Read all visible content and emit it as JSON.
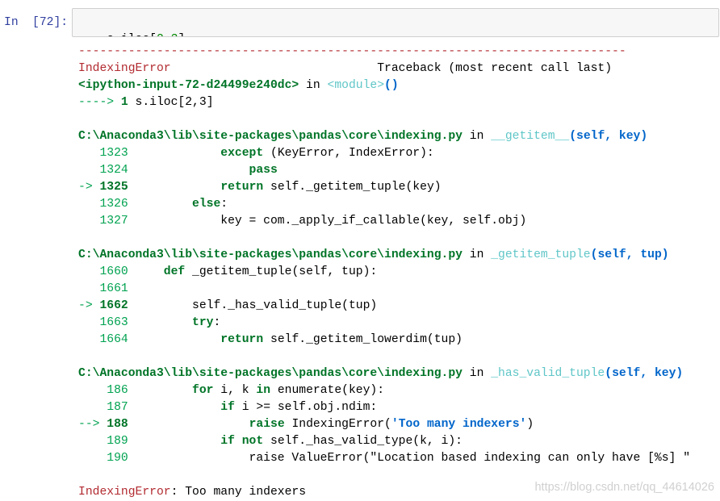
{
  "input_cell": {
    "prompt": "In [72]:",
    "code": [
      {
        "t": "s.iloc[",
        "k": "code-text"
      },
      {
        "t": "2",
        "k": "number-literal"
      },
      {
        "t": ",",
        "k": "code-text"
      },
      {
        "t": "3",
        "k": "number-literal"
      },
      {
        "t": "]",
        "k": "code-text"
      }
    ]
  },
  "output": {
    "lines": [
      [
        {
          "t": "-----------------------------------------------------------------------------",
          "k": "separator"
        }
      ],
      [
        {
          "t": "IndexingError",
          "k": "error-name"
        },
        {
          "t": "                             ",
          "k": "code-text"
        },
        {
          "t": "Traceback (most recent call last)",
          "k": "code-text"
        }
      ],
      [
        {
          "t": "<ipython-input-72-d24499e240dc>",
          "k": "file-path"
        },
        {
          "t": " in ",
          "k": "code-text"
        },
        {
          "t": "<module>",
          "k": "function-name"
        },
        {
          "t": "()",
          "k": "function-args"
        }
      ],
      [
        {
          "t": "---->",
          "k": "arrow-marker"
        },
        {
          "t": " ",
          "k": "code-text"
        },
        {
          "t": "1",
          "k": "current-line-number"
        },
        {
          "t": " s.iloc[2,3]",
          "k": "code-text"
        }
      ],
      [],
      [
        {
          "t": "C:\\Anaconda3\\lib\\site-packages\\pandas\\core\\indexing.py",
          "k": "file-path"
        },
        {
          "t": " in ",
          "k": "code-text"
        },
        {
          "t": "__getitem__",
          "k": "function-name"
        },
        {
          "t": "(self, key)",
          "k": "function-args"
        }
      ],
      [
        {
          "t": "   1323",
          "k": "line-number"
        },
        {
          "t": "             ",
          "k": "code-text"
        },
        {
          "t": "except",
          "k": "keyword"
        },
        {
          "t": " (KeyError, IndexError):",
          "k": "code-text"
        }
      ],
      [
        {
          "t": "   1324",
          "k": "line-number"
        },
        {
          "t": "                 ",
          "k": "code-text"
        },
        {
          "t": "pass",
          "k": "keyword"
        }
      ],
      [
        {
          "t": "->",
          "k": "arrow-marker"
        },
        {
          "t": " ",
          "k": "code-text"
        },
        {
          "t": "1325",
          "k": "current-line-number"
        },
        {
          "t": "             ",
          "k": "code-text"
        },
        {
          "t": "return",
          "k": "keyword"
        },
        {
          "t": " self._getitem_tuple(key)",
          "k": "code-text"
        }
      ],
      [
        {
          "t": "   1326",
          "k": "line-number"
        },
        {
          "t": "         ",
          "k": "code-text"
        },
        {
          "t": "else",
          "k": "keyword"
        },
        {
          "t": ":",
          "k": "code-text"
        }
      ],
      [
        {
          "t": "   1327",
          "k": "line-number"
        },
        {
          "t": "             key = com._apply_if_callable(key, self.obj)",
          "k": "code-text"
        }
      ],
      [],
      [
        {
          "t": "C:\\Anaconda3\\lib\\site-packages\\pandas\\core\\indexing.py",
          "k": "file-path"
        },
        {
          "t": " in ",
          "k": "code-text"
        },
        {
          "t": "_getitem_tuple",
          "k": "function-name"
        },
        {
          "t": "(self, tup)",
          "k": "function-args"
        }
      ],
      [
        {
          "t": "   1660",
          "k": "line-number"
        },
        {
          "t": "     ",
          "k": "code-text"
        },
        {
          "t": "def",
          "k": "keyword"
        },
        {
          "t": " _getitem_tuple(self, tup):",
          "k": "code-text"
        }
      ],
      [
        {
          "t": "   1661",
          "k": "line-number"
        }
      ],
      [
        {
          "t": "->",
          "k": "arrow-marker"
        },
        {
          "t": " ",
          "k": "code-text"
        },
        {
          "t": "1662",
          "k": "current-line-number"
        },
        {
          "t": "         self._has_valid_tuple(tup)",
          "k": "code-text"
        }
      ],
      [
        {
          "t": "   1663",
          "k": "line-number"
        },
        {
          "t": "         ",
          "k": "code-text"
        },
        {
          "t": "try",
          "k": "keyword"
        },
        {
          "t": ":",
          "k": "code-text"
        }
      ],
      [
        {
          "t": "   1664",
          "k": "line-number"
        },
        {
          "t": "             ",
          "k": "code-text"
        },
        {
          "t": "return",
          "k": "keyword"
        },
        {
          "t": " self._getitem_lowerdim(tup)",
          "k": "code-text"
        }
      ],
      [],
      [
        {
          "t": "C:\\Anaconda3\\lib\\site-packages\\pandas\\core\\indexing.py",
          "k": "file-path"
        },
        {
          "t": " in ",
          "k": "code-text"
        },
        {
          "t": "_has_valid_tuple",
          "k": "function-name"
        },
        {
          "t": "(self, key)",
          "k": "function-args"
        }
      ],
      [
        {
          "t": "    186",
          "k": "line-number"
        },
        {
          "t": "         ",
          "k": "code-text"
        },
        {
          "t": "for",
          "k": "keyword"
        },
        {
          "t": " i, k ",
          "k": "code-text"
        },
        {
          "t": "in",
          "k": "keyword"
        },
        {
          "t": " enumerate(key):",
          "k": "code-text"
        }
      ],
      [
        {
          "t": "    187",
          "k": "line-number"
        },
        {
          "t": "             ",
          "k": "code-text"
        },
        {
          "t": "if",
          "k": "keyword"
        },
        {
          "t": " i >= self.obj.ndim:",
          "k": "code-text"
        }
      ],
      [
        {
          "t": "-->",
          "k": "arrow-marker"
        },
        {
          "t": " ",
          "k": "code-text"
        },
        {
          "t": "188",
          "k": "current-line-number"
        },
        {
          "t": "                 ",
          "k": "code-text"
        },
        {
          "t": "raise",
          "k": "keyword"
        },
        {
          "t": " IndexingError(",
          "k": "code-text"
        },
        {
          "t": "'Too many indexers'",
          "k": "string-literal"
        },
        {
          "t": ")",
          "k": "code-text"
        }
      ],
      [
        {
          "t": "    189",
          "k": "line-number"
        },
        {
          "t": "             ",
          "k": "code-text"
        },
        {
          "t": "if not",
          "k": "keyword"
        },
        {
          "t": " self._has_valid_type(k, i):",
          "k": "code-text"
        }
      ],
      [
        {
          "t": "    190",
          "k": "line-number"
        },
        {
          "t": "                 raise ValueError(\"Location based indexing can only have [%s] \"",
          "k": "code-text"
        }
      ],
      [],
      [
        {
          "t": "IndexingError",
          "k": "error-name"
        },
        {
          "t": ": Too many indexers",
          "k": "code-text"
        }
      ]
    ]
  },
  "watermark": "https://blog.csdn.net/qq_44614026",
  "colors": {
    "separator": "#B22B31",
    "error-name": "#B22B31",
    "arrow-marker": "#00A250",
    "line-number": "#00A250",
    "current-line-number": "#007427",
    "keyword": "#007427",
    "file-path": "#007427",
    "function-name": "#60C6C8",
    "function-args": "#0065CA",
    "string-literal": "#0065CA",
    "code-text": "#000000",
    "number-literal": "#008800",
    "prompt": "#303F9F",
    "input-bg": "#F7F7F7",
    "input-border": "#CFCFCF",
    "watermark": "#D0D0D0"
  }
}
